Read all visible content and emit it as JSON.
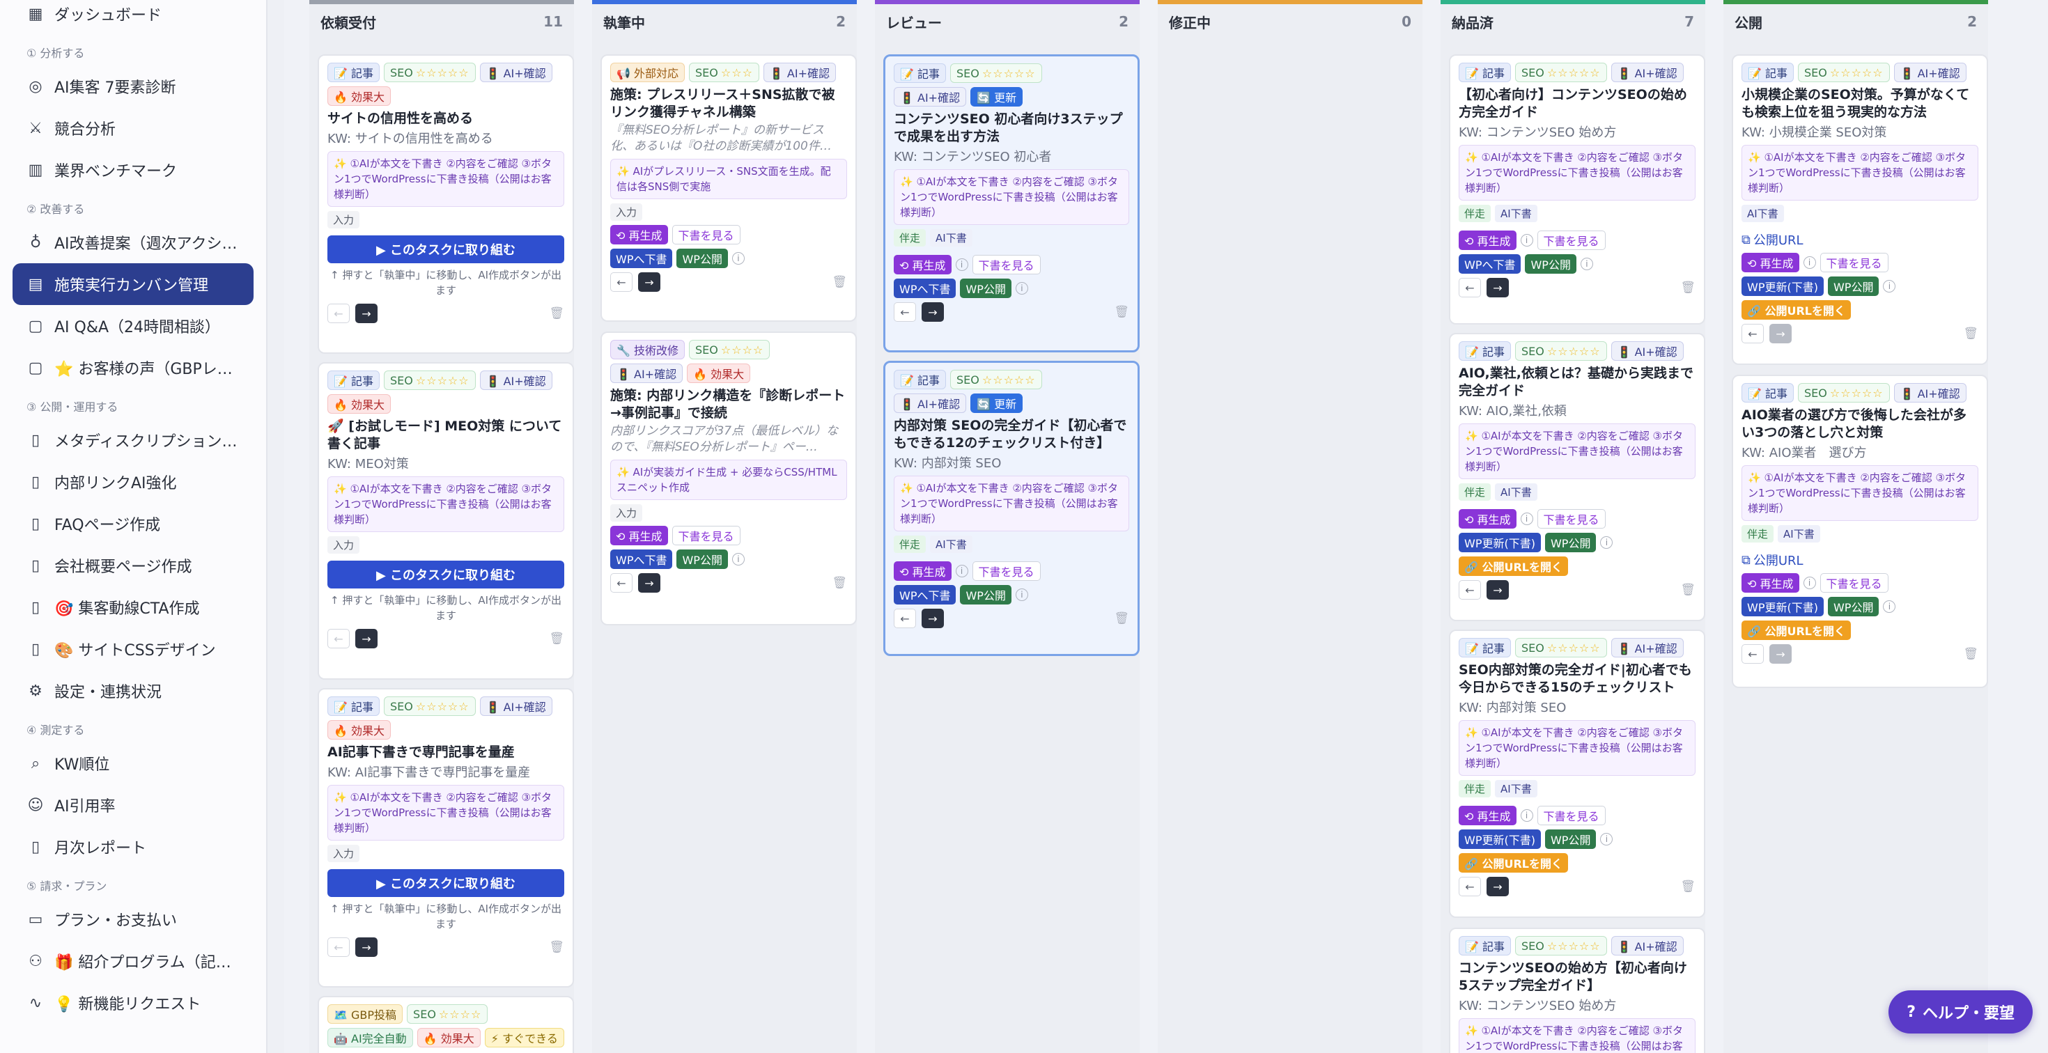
{
  "sidebar": {
    "top_item": "ダッシュボード",
    "sections": [
      {
        "label": "① 分析する",
        "items": [
          "AI集客 7要素診断",
          "競合分析",
          "業界ベンチマーク"
        ]
      },
      {
        "label": "② 改善する",
        "items": [
          "AI改善提案（週次アクショ…",
          "施策実行カンバン管理",
          "AI Q&A（24時間相談）",
          "⭐ お客様の声（GBPレビ…"
        ]
      },
      {
        "label": "③ 公開・運用する",
        "items": [
          "メタディスクリプション最…",
          "内部リンクAI強化",
          "FAQページ作成",
          "会社概要ページ作成",
          "🎯 集客動線CTA作成",
          "🎨 サイトCSSデザイン",
          "設定・連携状況"
        ]
      },
      {
        "label": "④ 測定する",
        "items": [
          "KW順位",
          "AI引用率",
          "月次レポート"
        ]
      },
      {
        "label": "⑤ 請求・プラン",
        "items": [
          "プラン・お支払い",
          "🎁 紹介プログラム（記事1…",
          "💡 新機能リクエスト"
        ]
      }
    ]
  },
  "columns": [
    {
      "name": "依頼受付",
      "count": "11",
      "color": "#9aa0ab"
    },
    {
      "name": "執筆中",
      "count": "2",
      "color": "#3b6fe0"
    },
    {
      "name": "レビュー",
      "count": "2",
      "color": "#8a4fd8"
    },
    {
      "name": "修正中",
      "count": "0",
      "color": "#e8a23a"
    },
    {
      "name": "納品済",
      "count": "7",
      "color": "#2fb38a"
    },
    {
      "name": "公開",
      "count": "2",
      "color": "#3a9a4a"
    }
  ],
  "tags": {
    "article": "📝 記事",
    "seo": "SEO",
    "stars": "☆☆☆☆☆",
    "stars3": "☆☆☆",
    "stars4": "☆☆☆☆",
    "ai_check": "🚦 AI+確認",
    "hot": "🔥 効果大",
    "external": "📢 外部対応",
    "tech": "🔧 技術改修",
    "update": "🔄 更新",
    "gbp": "🗺️ GBP投稿",
    "ai_auto": "🤖 AI完全自動",
    "quick": "⚡ すぐできる"
  },
  "common": {
    "hint": "✨ ①AIが本文を下書き ②内容をご確認 ③ボタン1つでWordPressに下書き投稿（公開はお客様判断）",
    "input": "入力",
    "go_button": "▶ このタスクに取り組む",
    "go_note": "↑ 押すと「執筆中」に移動し、AI作成ボタンが出ます",
    "accompany": "伴走",
    "ai_draft": "AI下書",
    "regen": "⟲ 再生成",
    "view_draft": "下書を見る",
    "wp_draft": "WPへ下書",
    "wp_publish": "WP公開",
    "wp_update": "WP更新(下書)",
    "open_url": "🔗 公開URLを開く",
    "public_url": "公開URL",
    "prev": "←",
    "next": "→"
  },
  "cards": {
    "c1_1": {
      "title": "サイトの信用性を高める",
      "kw": "KW: サイトの信用性を高める"
    },
    "c1_2": {
      "title": "🚀 [お試しモード] MEO対策 について書く記事",
      "kw": "KW: MEO対策"
    },
    "c1_3": {
      "title": "AI記事下書きで専門記事を量産",
      "kw": "KW: AI記事下書きで専門記事を量産"
    },
    "c2_1": {
      "title": "施策: プレスリリース＋SNS拡散で被リンク獲得チャネル構築",
      "desc": "『無料SEO分析レポート』の新サービス化、あるいは『O社の診断実績が100件…",
      "hint": "✨ AIがプレスリリース・SNS文面を生成。配信は各SNS側で実施"
    },
    "c2_2": {
      "title": "施策: 内部リンク構造を『診断レポート→事例記事』で接続",
      "desc": "内部リンクスコアが37点（最低レベル）なので、『無料SEO分析レポート』ペー…",
      "hint": "✨ AIが実装ガイド生成 + 必要ならCSS/HTML スニペット作成"
    },
    "c3_1": {
      "title": "コンテンツSEO 初心者向け3ステップで成果を出す方法",
      "kw": "KW: コンテンツSEO 初心者"
    },
    "c3_2": {
      "title": "内部対策 SEOの完全ガイド【初心者でもできる12のチェックリスト付き】",
      "kw": "KW: 内部対策 SEO"
    },
    "c5_1": {
      "title": "【初心者向け】コンテンツSEOの始め方完全ガイド",
      "kw": "KW: コンテンツSEO 始め方"
    },
    "c5_2": {
      "title": "AIO,業社,依頼とは？基礎から実践まで完全ガイド",
      "kw": "KW: AIO,業社,依頼"
    },
    "c5_3": {
      "title": "SEO内部対策の完全ガイド|初心者でも今日からできる15のチェックリスト",
      "kw": "KW: 内部対策 SEO"
    },
    "c5_4": {
      "title": "コンテンツSEOの始め方【初心者向け5ステップ完全ガイド】",
      "kw": "KW: コンテンツSEO 始め方"
    },
    "c6_1": {
      "title": "小規模企業のSEO対策。予算がなくても検索上位を狙う現実的な方法",
      "kw": "KW: 小規模企業 SEO対策"
    },
    "c6_2": {
      "title": "AIO業者の選び方で後悔した会社が多い3つの落とし穴と対策",
      "kw": "KW: AIO業者　選び方"
    }
  },
  "help": {
    "label": "ヘルプ・要望"
  }
}
